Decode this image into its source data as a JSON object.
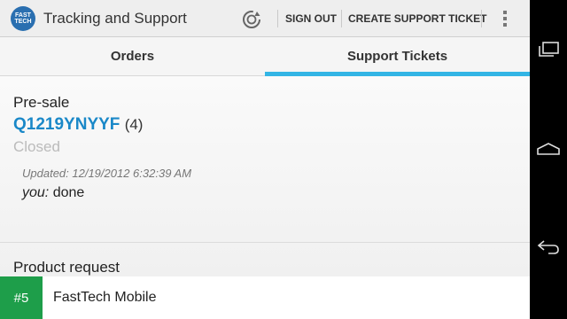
{
  "app": {
    "logo_text": "FAST TECH",
    "title": "Tracking and Support"
  },
  "toolbar": {
    "refresh_icon": "refresh-icon",
    "sign_out": "SIGN OUT",
    "create_ticket": "CREATE SUPPORT TICKET",
    "overflow_icon": "overflow-menu-icon"
  },
  "tabs": [
    {
      "label": "Orders",
      "active": false
    },
    {
      "label": "Support Tickets",
      "active": true
    }
  ],
  "tickets": [
    {
      "category": "Pre-sale",
      "id": "Q1219YNYYF",
      "count": "(4)",
      "status": "Closed",
      "updated": "Updated: 12/19/2012 6:32:39 AM",
      "author": "you:",
      "message": "done"
    },
    {
      "category": "Product request"
    }
  ],
  "banner": {
    "rank": "#5",
    "name": "FastTech Mobile"
  },
  "colors": {
    "accent": "#33b5e5",
    "ticket_id": "#1a88c8",
    "badge": "#1e9e4a"
  }
}
